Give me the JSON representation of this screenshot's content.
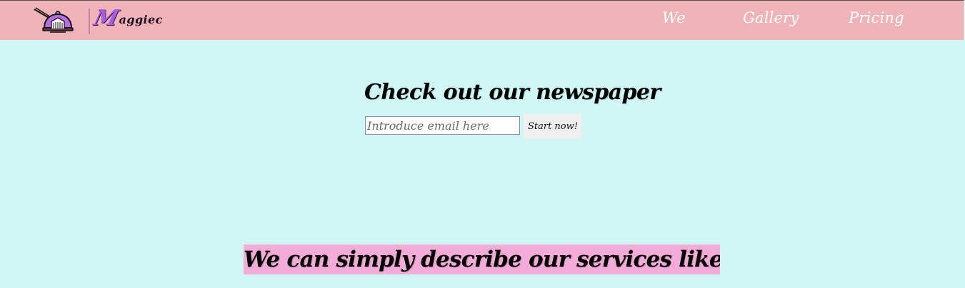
{
  "brand": {
    "logo_initial": "M",
    "logo_rest": "aggiec"
  },
  "nav": {
    "items": [
      {
        "label": "We"
      },
      {
        "label": "Gallery"
      },
      {
        "label": "Pricing"
      }
    ]
  },
  "newsletter": {
    "title": "Check out our newspaper",
    "email_placeholder": "Introduce email here",
    "button_label": "Start now!"
  },
  "services": {
    "heading": "We can simply describe our services like this:"
  },
  "colors": {
    "header_background": "#f0b4b8",
    "page_background": "#cef7f5",
    "banner_background": "#f3acd8",
    "logo_accent": "#a45ee3",
    "nav_text": "#ffffff"
  },
  "icons": {
    "logo": "cloche-icon"
  }
}
